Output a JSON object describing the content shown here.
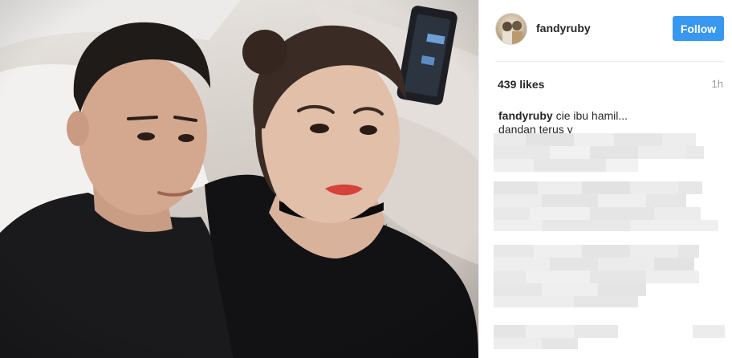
{
  "post": {
    "username": "fandyruby",
    "follow_label": "Follow",
    "likes": "439 likes",
    "time": "1h",
    "caption": {
      "user": "fandyruby",
      "line1": "cie ibu hamil...",
      "line2": "dandan terus y"
    }
  },
  "colors": {
    "follow_button": "#3897f0",
    "muted_text": "#999999",
    "text": "#262626"
  }
}
